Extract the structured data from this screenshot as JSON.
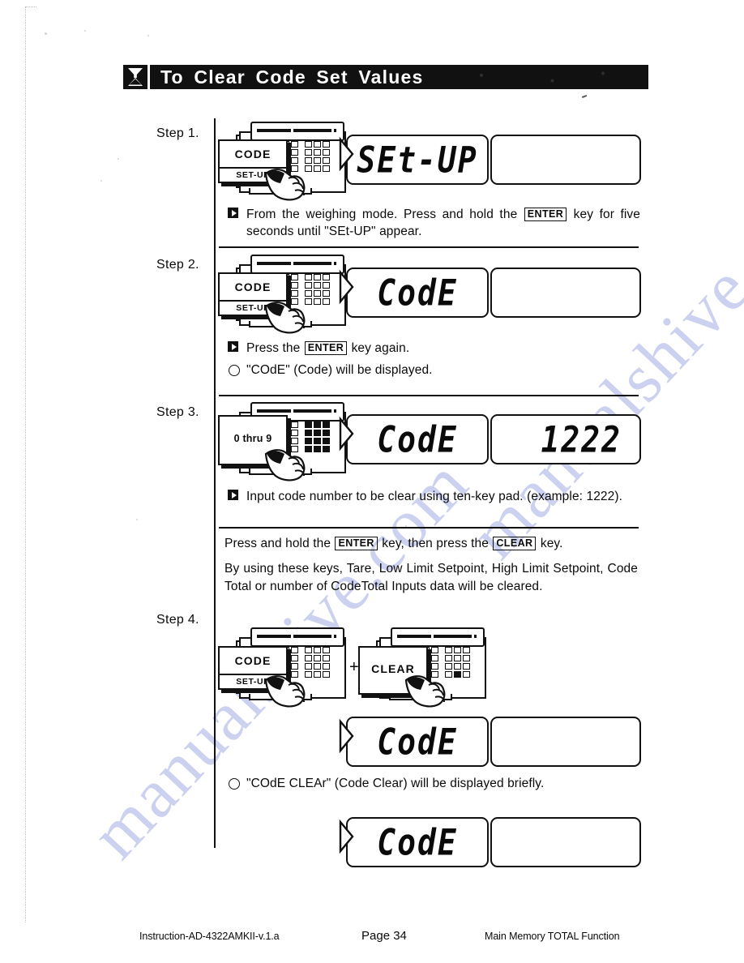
{
  "header": {
    "title": "To Clear Code Set Values",
    "icon": "hourglass-funnel-icon"
  },
  "watermark": {
    "text": "manualshive.com",
    "color": "#adb6e8"
  },
  "steps": [
    {
      "label": "Step 1.",
      "device": {
        "callout_main": "CODE",
        "callout_sub": "SET-UP",
        "hand": "pointing-hand-icon"
      },
      "display_primary": "SEt-UP",
      "display_secondary": "",
      "notes": [
        {
          "marker": "square-arrow",
          "segments": [
            {
              "type": "text",
              "value": "From the weighing mode. Press and hold the "
            },
            {
              "type": "keycap",
              "value": "ENTER"
            },
            {
              "type": "text",
              "value": " key for five seconds until \"SEt-UP\" appear."
            }
          ]
        }
      ]
    },
    {
      "label": "Step 2.",
      "device": {
        "callout_main": "CODE",
        "callout_sub": "SET-UP",
        "hand": "pointing-hand-icon"
      },
      "display_primary": "CodE",
      "display_secondary": "",
      "notes": [
        {
          "marker": "square-arrow",
          "segments": [
            {
              "type": "text",
              "value": "Press the "
            },
            {
              "type": "keycap",
              "value": "ENTER"
            },
            {
              "type": "text",
              "value": " key again."
            }
          ]
        },
        {
          "marker": "circle",
          "segments": [
            {
              "type": "text",
              "value": "\"COdE\" (Code) will be displayed."
            }
          ]
        }
      ]
    },
    {
      "label": "Step 3.",
      "device": {
        "callout_main": "0 thru 9",
        "callout_sub": "",
        "hand": "pointing-hand-icon"
      },
      "display_primary": "CodE",
      "display_secondary": "1222",
      "notes": [
        {
          "marker": "square-arrow",
          "segments": [
            {
              "type": "text",
              "value": "Input code number to be clear using ten-key pad. (example: 1222)."
            }
          ]
        }
      ]
    },
    {
      "label": "Step 4.",
      "device": {
        "callout_main": "CODE",
        "callout_sub": "SET-UP",
        "hand": "pointing-hand-icon"
      },
      "device2": {
        "callout_main": "CLEAR",
        "callout_sub": "",
        "hand": "pointing-hand-icon"
      },
      "combiner": "+",
      "display_primary": "CodE",
      "display_secondary": "",
      "display_primary_2": "CodE",
      "display_secondary_2": "",
      "notes": [
        {
          "marker": "circle",
          "segments": [
            {
              "type": "text",
              "value": "\"COdE CLEAr\" (Code Clear) will be displayed briefly."
            }
          ]
        }
      ]
    }
  ],
  "interlude": {
    "line1": [
      {
        "type": "text",
        "value": "Press and hold the "
      },
      {
        "type": "keycap",
        "value": "ENTER"
      },
      {
        "type": "text",
        "value": " key, then press the "
      },
      {
        "type": "keycap",
        "value": "CLEAR"
      },
      {
        "type": "text",
        "value": " key."
      }
    ],
    "line2": "By using these keys, Tare, Low Limit Setpoint, High Limit Setpoint, Code Total or number of CodeTotal Inputs data will be cleared."
  },
  "footer": {
    "left": "Instruction-AD-4322AMKII-v.1.a",
    "center": "Page 34",
    "right": "Main Memory TOTAL Function"
  }
}
